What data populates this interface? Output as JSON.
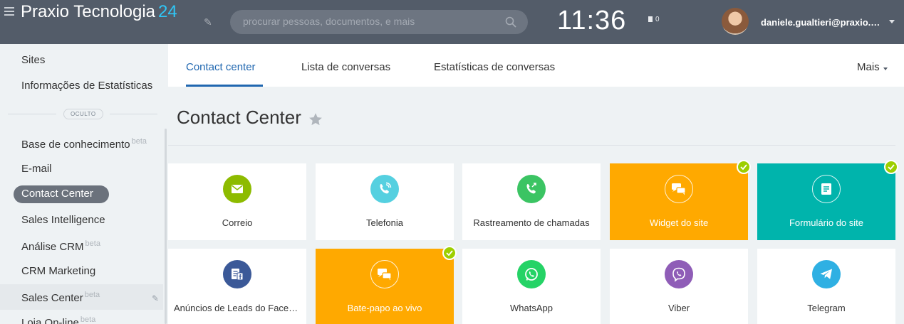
{
  "header": {
    "brand": "Praxio Tecnologia",
    "brand_number": "24",
    "search_placeholder": "procurar pessoas, documentos, e mais",
    "clock": "11:36",
    "flag_count": "0",
    "user": "daniele.gualtieri@praxio.com.br"
  },
  "sidebar": {
    "items": [
      {
        "label": "Sites"
      },
      {
        "label": "Informações de Estatísticas"
      },
      {
        "label": "Base de conhecimento",
        "badge": "beta"
      },
      {
        "label": "E-mail"
      },
      {
        "label": "Contact Center"
      },
      {
        "label": "Sales Intelligence"
      },
      {
        "label": "Análise CRM",
        "badge": "beta"
      },
      {
        "label": "CRM Marketing"
      },
      {
        "label": "Sales Center",
        "badge": "beta"
      },
      {
        "label": "Loja On-line",
        "badge": "beta"
      }
    ],
    "divider_label": "OCULTO"
  },
  "tabs": [
    {
      "label": "Contact center"
    },
    {
      "label": "Lista de conversas"
    },
    {
      "label": "Estatísticas de conversas"
    }
  ],
  "more_label": "Mais",
  "page_title": "Contact Center",
  "tiles": [
    {
      "label": "Correio",
      "icon": "envelope-icon",
      "color": "#8dbb00"
    },
    {
      "label": "Telefonia",
      "icon": "phone-icon",
      "color": "#55d0e0"
    },
    {
      "label": "Rastreamento de chamadas",
      "icon": "call-tracking-icon",
      "color": "#3bc463"
    },
    {
      "label": "Widget do site",
      "icon": "chat-bubbles-icon",
      "color": "#ffa900"
    },
    {
      "label": "Formulário do site",
      "icon": "form-icon",
      "color": "#00b4ac"
    },
    {
      "label": "Anúncios de Leads do Facebook",
      "icon": "facebook-form-icon",
      "color": "#3b5998"
    },
    {
      "label": "Bate-papo ao vivo",
      "icon": "chat-bubbles-icon",
      "color": "#ffa900"
    },
    {
      "label": "WhatsApp",
      "icon": "whatsapp-icon",
      "color": "#25d366"
    },
    {
      "label": "Viber",
      "icon": "viber-icon",
      "color": "#8f5db7"
    },
    {
      "label": "Telegram",
      "icon": "telegram-icon",
      "color": "#2fb0e3"
    }
  ],
  "colors": {
    "header_bg": "#535c69",
    "accent_blue": "#2067b0",
    "check_green": "#9dcf00"
  }
}
